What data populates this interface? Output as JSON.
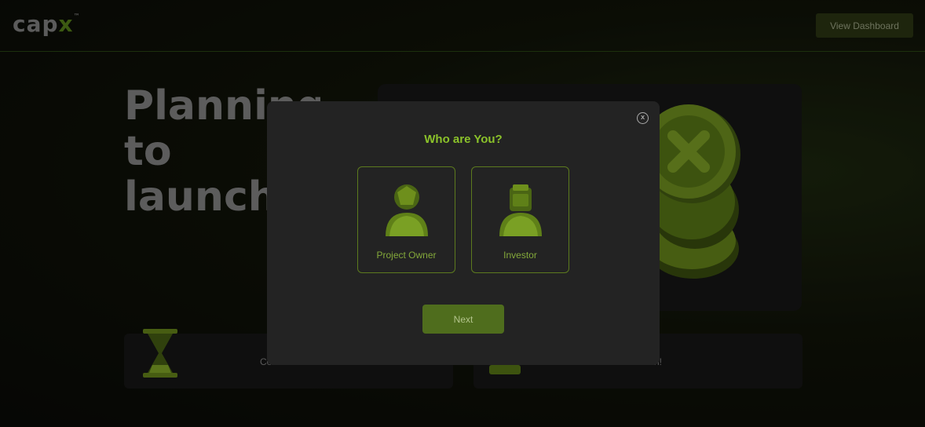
{
  "header": {
    "logo": {
      "main": "cap",
      "accent": "x",
      "mark": "™"
    },
    "view_dashboard_label": "View Dashboard"
  },
  "hero": {
    "title": "Planning\nto launch\nan ICO?"
  },
  "features": [
    {
      "text": "Co"
    },
    {
      "text": "n!"
    }
  ],
  "modal": {
    "close_label": "x",
    "title": "Who are You?",
    "roles": [
      {
        "label": "Project Owner",
        "icon": "person-icon"
      },
      {
        "label": "Investor",
        "icon": "investor-icon"
      }
    ],
    "next_label": "Next"
  },
  "colors": {
    "accent": "#8bc22a",
    "button_dark": "#2e3a14",
    "next_button": "#4f6d1d",
    "modal_bg": "#232323"
  }
}
